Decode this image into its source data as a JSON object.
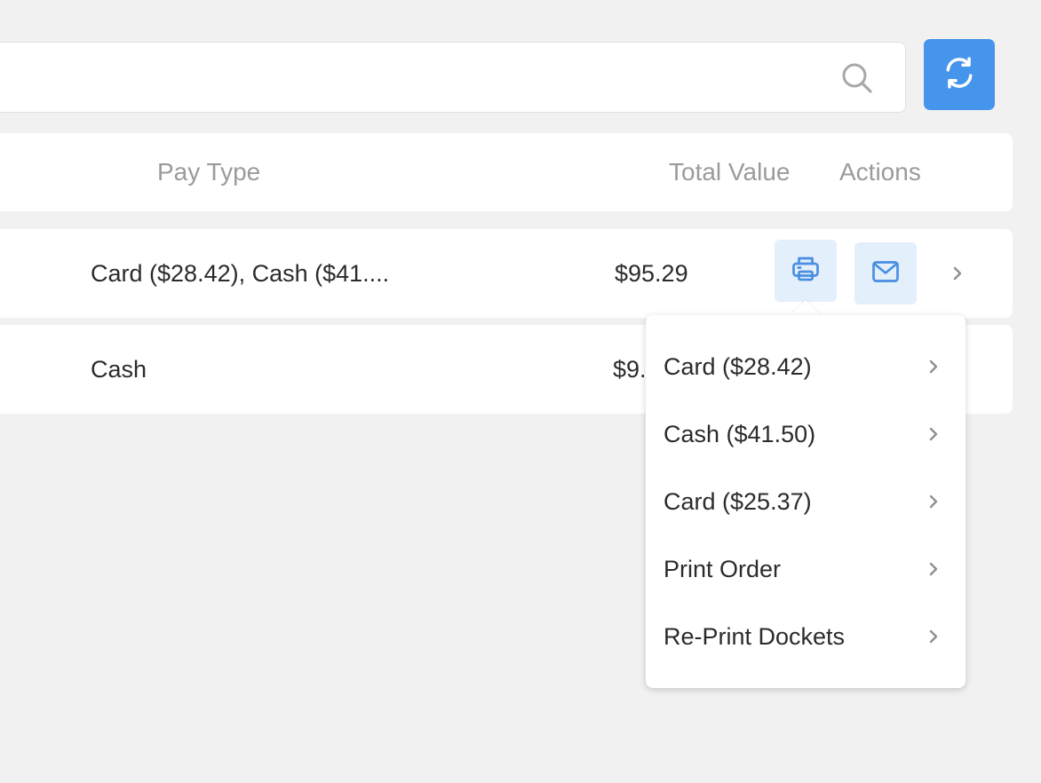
{
  "search": {
    "value": "",
    "placeholder": ""
  },
  "table": {
    "columns": {
      "pay_type": "Pay Type",
      "total_value": "Total Value",
      "actions": "Actions"
    },
    "rows": [
      {
        "pay_type": "Card ($28.42), Cash ($41....",
        "total_value": "$95.29"
      },
      {
        "pay_type": "Cash",
        "total_value": "$9."
      }
    ]
  },
  "print_menu": {
    "items": [
      {
        "label": "Card ($28.42)"
      },
      {
        "label": "Cash ($41.50)"
      },
      {
        "label": "Card ($25.37)"
      },
      {
        "label": "Print Order"
      },
      {
        "label": "Re-Print Dockets"
      }
    ]
  },
  "colors": {
    "accent": "#4695ec",
    "action_bg": "#e3effb",
    "icon_blue": "#4a8fe2"
  }
}
